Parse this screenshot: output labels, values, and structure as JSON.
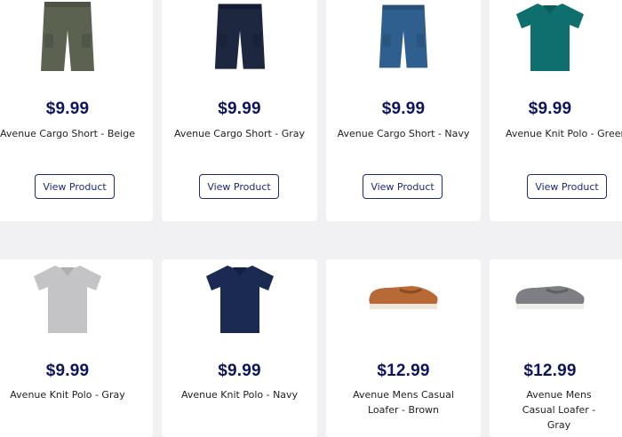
{
  "products": [
    {
      "price": "$9.99",
      "name": "Avenue Cargo Short - Beige",
      "button": "View Product",
      "image": "cargo-short-olive"
    },
    {
      "price": "$9.99",
      "name": "Avenue Cargo Short - Gray",
      "button": "View Product",
      "image": "cargo-short-navy"
    },
    {
      "price": "$9.99",
      "name": "Avenue Cargo Short - Navy",
      "button": "View Product",
      "image": "cargo-short-blue"
    },
    {
      "price": "$9.99",
      "name": "Avenue Knit Polo - Green",
      "button": "View Product",
      "image": "polo-teal"
    },
    {
      "price": "$9.99",
      "name": "Avenue Knit Polo - Gray",
      "image": "polo-gray"
    },
    {
      "price": "$9.99",
      "name": "Avenue Knit Polo - Navy",
      "image": "polo-navy"
    },
    {
      "price": "$12.99",
      "name": "Avenue Mens Casual Loafer - Brown",
      "image": "loafer-brown"
    },
    {
      "price": "$12.99",
      "name": "Avenue Mens Casual Loafer - Gray",
      "image": "loafer-gray"
    }
  ],
  "colors": {
    "price": "#0d1560",
    "button_border": "#1c2a7a",
    "page_bg": "#f1f1f3"
  }
}
